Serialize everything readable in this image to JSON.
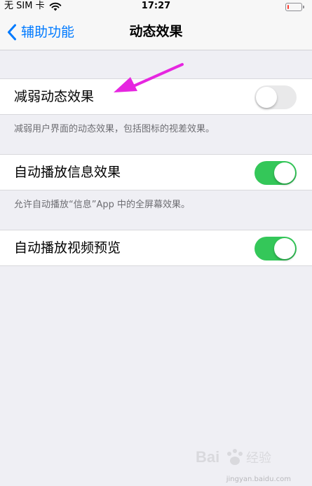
{
  "status_bar": {
    "carrier": "无 SIM 卡",
    "time": "17:27",
    "battery_level": 0.08,
    "battery_color": "#ff3b30",
    "icons": [
      "wifi-icon",
      "battery-icon"
    ]
  },
  "nav": {
    "back_label": "辅助功能",
    "title": "动态效果",
    "accent_color": "#007aff"
  },
  "settings": [
    {
      "label": "减弱动态效果",
      "on": false,
      "footer": "减弱用户界面的动态效果，包括图标的视差效果。"
    },
    {
      "label": "自动播放信息效果",
      "on": true,
      "footer": "允许自动播放“信息”App 中的全屏幕效果。"
    },
    {
      "label": "自动播放视频预览",
      "on": true
    }
  ],
  "toggle_on_color": "#34c759",
  "annotation": {
    "icon": "arrow-icon",
    "color": "#e626e0"
  },
  "watermark": {
    "text": "jingyan.baidu.com"
  }
}
